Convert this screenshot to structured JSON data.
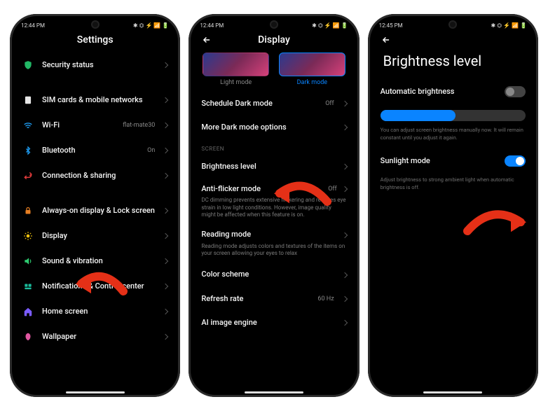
{
  "status": {
    "time1": "12:44 PM",
    "time2": "12:44 PM",
    "time3": "12:45 PM",
    "left_icons": "⋈ ⋯",
    "right_icons": "✱ ⏣ ⚡ 📶 🔋"
  },
  "phone1": {
    "title": "Settings",
    "items": [
      {
        "icon": "shield-icon",
        "cls": "ic-shield",
        "label": "Security status"
      },
      {
        "gap": true
      },
      {
        "icon": "sim-icon",
        "cls": "ic-sim",
        "label": "SIM cards & mobile networks"
      },
      {
        "icon": "wifi-icon",
        "cls": "ic-wifi",
        "label": "Wi-Fi",
        "value": "flat-mate30"
      },
      {
        "icon": "bluetooth-icon",
        "cls": "ic-bt",
        "label": "Bluetooth",
        "value": "On"
      },
      {
        "icon": "connection-icon",
        "cls": "ic-conn",
        "label": "Connection & sharing"
      },
      {
        "gap": true
      },
      {
        "icon": "lock-icon",
        "cls": "ic-lock",
        "label": "Always-on display & Lock screen"
      },
      {
        "icon": "display-icon",
        "cls": "ic-display",
        "label": "Display",
        "arrow": true
      },
      {
        "icon": "sound-icon",
        "cls": "ic-sound",
        "label": "Sound & vibration"
      },
      {
        "icon": "notifications-icon",
        "cls": "ic-notif",
        "label": "Notifications & Control center"
      },
      {
        "icon": "home-icon",
        "cls": "ic-home",
        "label": "Home screen"
      },
      {
        "icon": "wallpaper-icon",
        "cls": "ic-wall",
        "label": "Wallpaper"
      }
    ]
  },
  "phone2": {
    "title": "Display",
    "light_label": "Light mode",
    "dark_label": "Dark mode",
    "schedule": {
      "label": "Schedule Dark mode",
      "value": "Off"
    },
    "more_dark": {
      "label": "More Dark mode options"
    },
    "section_screen": "SCREEN",
    "brightness": {
      "label": "Brightness level",
      "arrow": true
    },
    "antiflicker": {
      "label": "Anti-flicker mode",
      "value": "Off",
      "sub": "DC dimming prevents extensive flickering and reduces eye strain in low light conditions. However, image quality might be affected when this feature is on."
    },
    "reading": {
      "label": "Reading mode",
      "sub": "Reading mode adjusts colors and textures of the items on your screen allowing your eyes to relax"
    },
    "color": {
      "label": "Color scheme"
    },
    "refresh": {
      "label": "Refresh rate",
      "value": "60 Hz"
    },
    "ai": {
      "label": "AI image engine"
    }
  },
  "phone3": {
    "title": "Brightness level",
    "auto_label": "Automatic brightness",
    "auto_on": false,
    "slider_pct": 52,
    "slider_help": "You can adjust screen brightness manually now. It will remain constant until you adjust it again.",
    "sunlight_label": "Sunlight mode",
    "sunlight_on": true,
    "sunlight_help": "Adjust brightness to strong ambient light when automatic brightness is off."
  },
  "colors": {
    "accent": "#0a84ff",
    "arrow": "#e53017"
  }
}
